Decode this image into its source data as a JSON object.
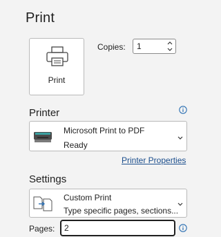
{
  "page": {
    "title": "Print"
  },
  "print_button": {
    "label": "Print",
    "icon": "printer-icon"
  },
  "copies": {
    "label": "Copies:",
    "value": "1"
  },
  "printer": {
    "heading": "Printer",
    "selected_name": "Microsoft Print to PDF",
    "selected_status": "Ready",
    "properties_link": "Printer Properties"
  },
  "settings": {
    "heading": "Settings",
    "selected_name": "Custom Print",
    "selected_description": "Type specific pages, sections..."
  },
  "pages": {
    "label": "Pages:",
    "value": "2"
  },
  "colors": {
    "accent": "#1a4d8c",
    "info": "#2b6fb3",
    "background": "#f3f3f3"
  }
}
